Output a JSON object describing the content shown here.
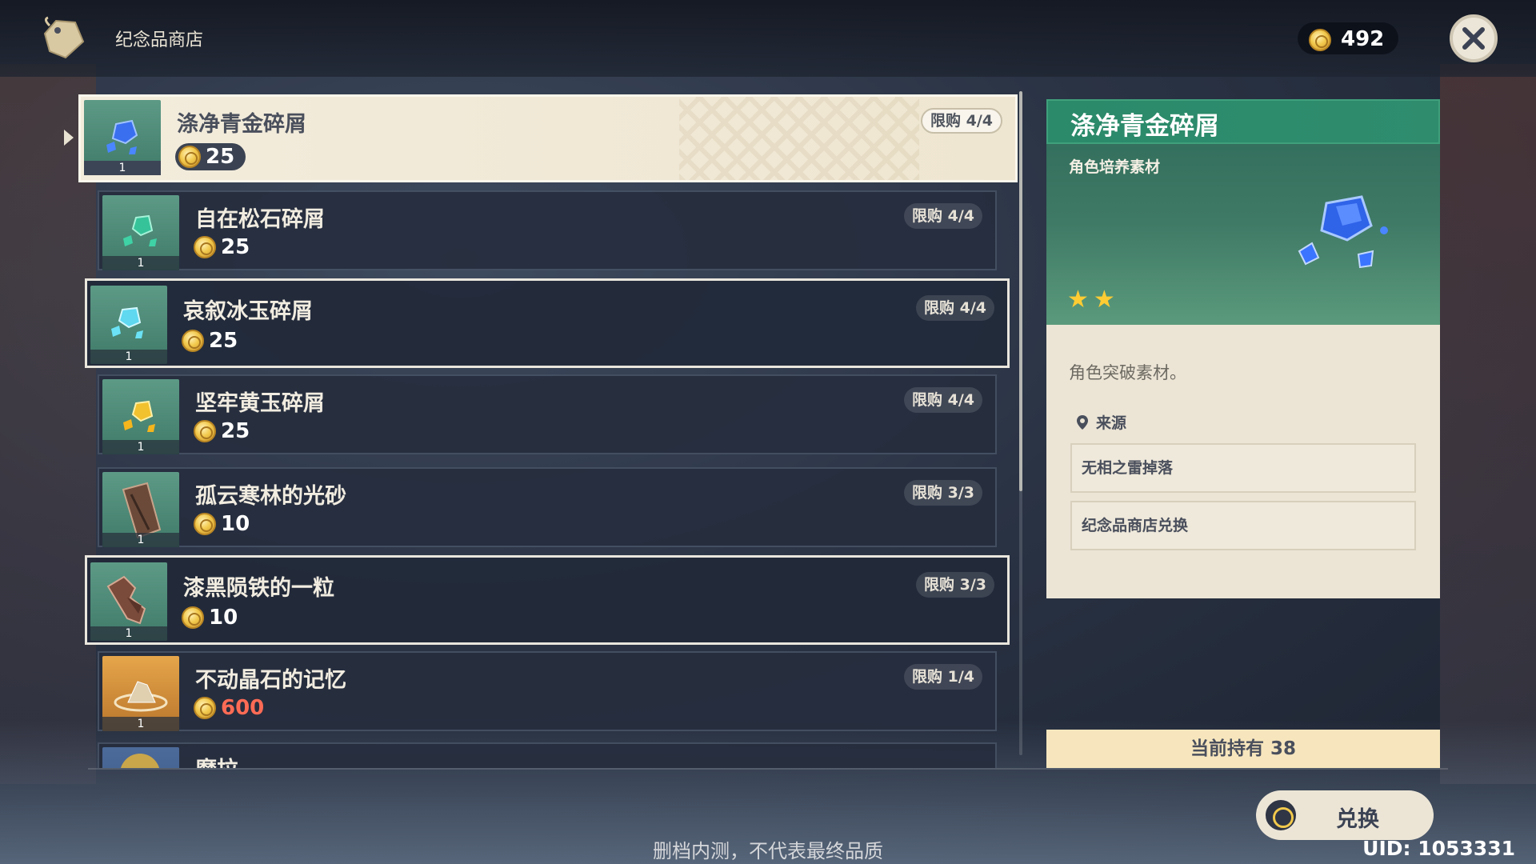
{
  "header": {
    "title": "纪念品商店",
    "currency_icon": "mora-coin-icon",
    "currency_amount": "492",
    "close_icon": "close-icon"
  },
  "items": [
    {
      "name": "涤净青金碎屑",
      "price": "25",
      "limit": "限购 4/4",
      "count": "1",
      "icon": "blue-gem-icon"
    },
    {
      "name": "自在松石碎屑",
      "price": "25",
      "limit": "限购 4/4",
      "count": "1",
      "icon": "green-gem-icon"
    },
    {
      "name": "哀叙冰玉碎屑",
      "price": "25",
      "limit": "限购 4/4",
      "count": "1",
      "icon": "cyan-gem-icon"
    },
    {
      "name": "坚牢黄玉碎屑",
      "price": "25",
      "limit": "限购 4/4",
      "count": "1",
      "icon": "yellow-gem-icon"
    },
    {
      "name": "孤云寒林的光砂",
      "price": "10",
      "limit": "限购 3/3",
      "count": "1",
      "icon": "brown-slab-icon"
    },
    {
      "name": "漆黑陨铁的一粒",
      "price": "10",
      "limit": "限购 3/3",
      "count": "1",
      "icon": "iron-chunk-icon"
    },
    {
      "name": "不动晶石的记忆",
      "price": "600",
      "limit": "限购 1/4",
      "count": "1",
      "icon": "stone-memory-icon"
    },
    {
      "name": "摩拉",
      "price": "",
      "limit": "",
      "count": "",
      "icon": "mora-icon"
    }
  ],
  "detail": {
    "title": "涤净青金碎屑",
    "type": "角色培养素材",
    "rarity": 2,
    "description": "角色突破素材。",
    "source_label": "来源",
    "sources": [
      "无相之雷掉落",
      "纪念品商店兑换"
    ]
  },
  "owned": "当前持有 38",
  "exchange_label": "兑换",
  "footer_notice": "删档内测，不代表最终品质",
  "uid": "UID: 1053331",
  "colors": {
    "accent_green": "#2a8a6a",
    "coin_gold": "#f2c94c",
    "expensive_red": "#ff6b55",
    "owned_bg": "#f7e6bd"
  }
}
